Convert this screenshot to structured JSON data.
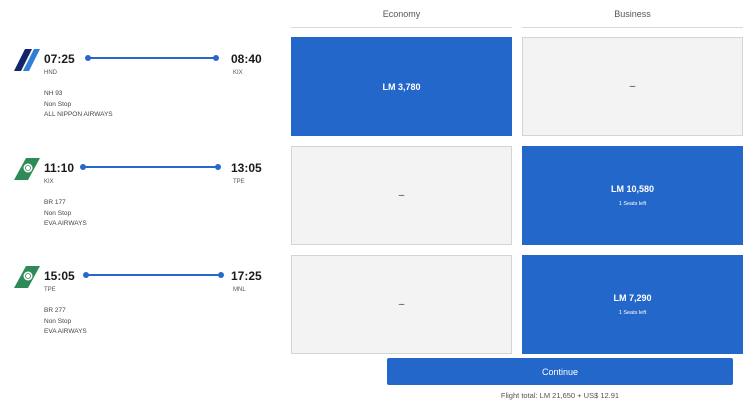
{
  "columns": {
    "economy": "Economy",
    "business": "Business"
  },
  "flights": [
    {
      "dep_time": "07:25",
      "dep_code": "HND",
      "arr_time": "08:40",
      "arr_code": "KIX",
      "flight_no": "NH 93",
      "stops": "Non Stop",
      "airline": "ALL NIPPON AIRWAYS",
      "logo_icon": "ana-logo-icon",
      "economy": {
        "price": "LM 3,780",
        "seats": ""
      },
      "business": {
        "price": "–",
        "seats": ""
      }
    },
    {
      "dep_time": "11:10",
      "dep_code": "KIX",
      "arr_time": "13:05",
      "arr_code": "TPE",
      "flight_no": "BR 177",
      "stops": "Non Stop",
      "airline": "EVA AIRWAYS",
      "logo_icon": "eva-logo-icon",
      "economy": {
        "price": "–",
        "seats": ""
      },
      "business": {
        "price": "LM 10,580",
        "seats": "1 Seats left"
      }
    },
    {
      "dep_time": "15:05",
      "dep_code": "TPE",
      "arr_time": "17:25",
      "arr_code": "MNL",
      "flight_no": "BR 277",
      "stops": "Non Stop",
      "airline": "EVA AIRWAYS",
      "logo_icon": "eva-logo-icon",
      "economy": {
        "price": "–",
        "seats": ""
      },
      "business": {
        "price": "LM 7,290",
        "seats": "1 Seats left"
      }
    }
  ],
  "continue_label": "Continue",
  "total": "Flight total: LM 21,650 + US$ 12.91",
  "colors": {
    "accent": "#2367cb",
    "unavailable": "#f3f3f4",
    "eva_green": "#2e8b57",
    "ana_navy": "#13246b"
  }
}
